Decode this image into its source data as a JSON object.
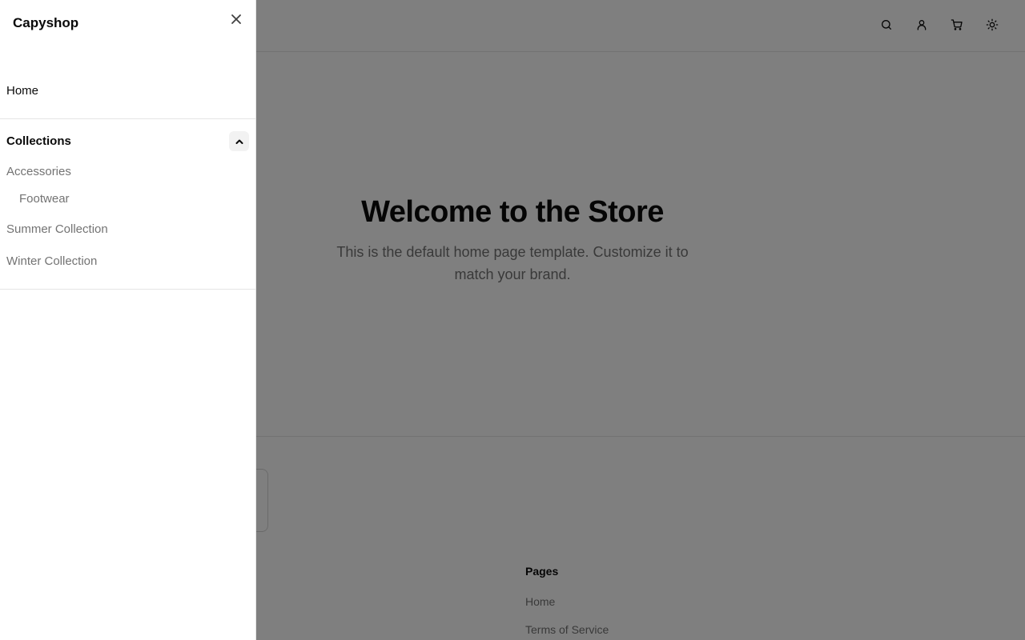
{
  "header": {
    "icons": [
      "search-icon",
      "user-icon",
      "cart-icon",
      "sun-icon"
    ]
  },
  "hero": {
    "title": "Welcome to the Store",
    "subtitle": "This is the default home page template. Customize it to match your brand."
  },
  "footer": {
    "pages_heading": "Pages",
    "links": [
      "Home",
      "Terms of Service"
    ]
  },
  "drawer": {
    "title": "Capyshop",
    "home_label": "Home",
    "collections_label": "Collections",
    "collections_expanded": true,
    "collections": [
      {
        "label": "Accessories"
      },
      {
        "label": "Footwear"
      },
      {
        "label": "Summer Collection"
      },
      {
        "label": "Winter Collection"
      }
    ]
  },
  "colors": {
    "text": "#0a0a0a",
    "muted": "#737373",
    "border": "#e5e5e5",
    "overlay": "rgba(0,0,0,0.5)"
  }
}
